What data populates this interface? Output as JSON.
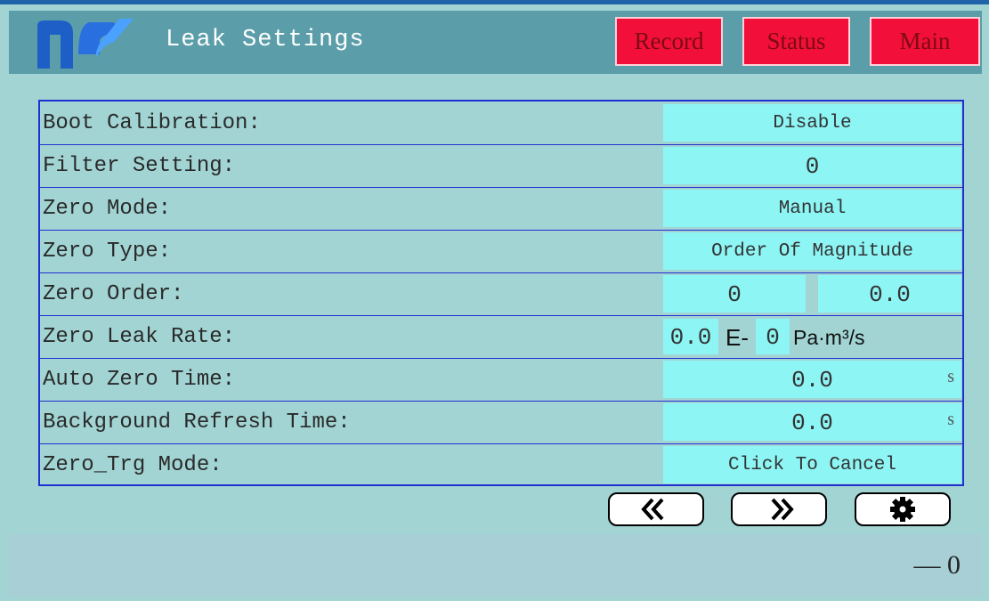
{
  "header": {
    "title": "Leak Settings",
    "logo_icon": "noy-logo",
    "nav": {
      "record": "Record",
      "status": "Status",
      "main": "Main"
    }
  },
  "colors": {
    "background": "#a2d4d4",
    "header": "#5b9ea9",
    "nav_button": "#f2103a",
    "field": "#8ef5f5",
    "grid_line": "#2030d0"
  },
  "form": {
    "rows": [
      {
        "label": "Boot Calibration:",
        "value": "Disable"
      },
      {
        "label": "Filter Setting:",
        "value": "0"
      },
      {
        "label": "Zero Mode:",
        "value": "Manual"
      },
      {
        "label": "Zero Type:",
        "value": "Order Of Magnitude"
      },
      {
        "label": "Zero Order:",
        "value_a": "0",
        "value_b": "0.0"
      },
      {
        "label": "Zero Leak Rate:",
        "mantissa": "0.0",
        "exp_sep": "E-",
        "exponent": "0",
        "unit": "Pa·m³/s"
      },
      {
        "label": "Auto Zero Time:",
        "value": "0.0",
        "unit": "s"
      },
      {
        "label": "Background Refresh Time:",
        "value": "0.0",
        "unit": "s"
      },
      {
        "label": "Zero_Trg Mode:",
        "value": "Click To Cancel"
      }
    ]
  },
  "pager": {
    "prev_icon": "double-chevron-left-icon",
    "next_icon": "double-chevron-right-icon",
    "settings_icon": "gear-icon"
  },
  "status_bar": {
    "value": "— 0"
  }
}
